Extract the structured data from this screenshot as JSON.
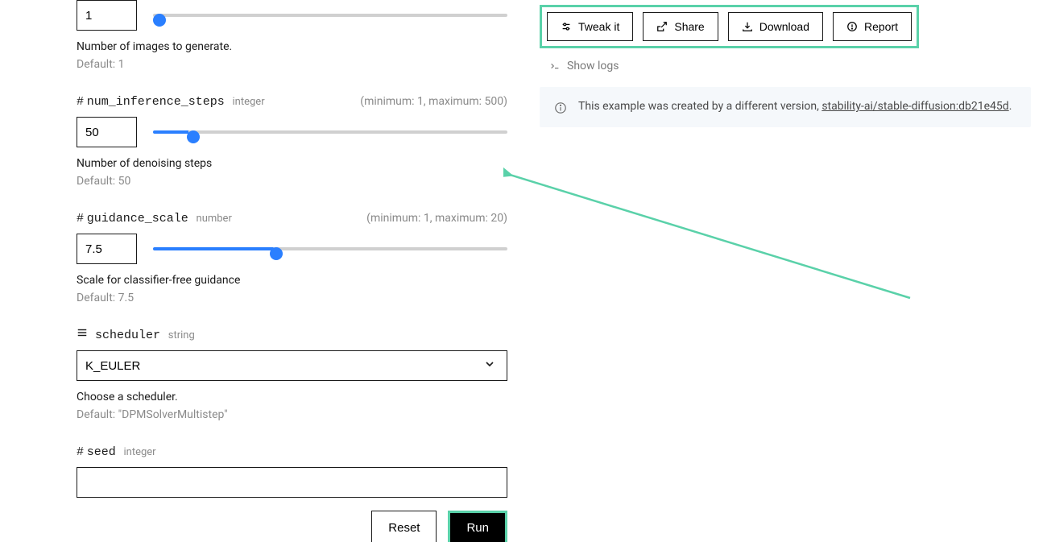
{
  "params": {
    "num_outputs": {
      "value": "1",
      "desc": "Number of images to generate.",
      "default": "Default: 1",
      "slider_min": 1,
      "slider_max": 4,
      "pct": "0%"
    },
    "num_inference_steps": {
      "label": "num_inference_steps",
      "type": "integer",
      "range": "(minimum: 1, maximum: 500)",
      "value": "50",
      "desc": "Number of denoising steps",
      "default": "Default: 50",
      "slider_min": 1,
      "slider_max": 500,
      "pct": "10%"
    },
    "guidance_scale": {
      "label": "guidance_scale",
      "type": "number",
      "range": "(minimum: 1, maximum: 20)",
      "value": "7.5",
      "desc": "Scale for classifier-free guidance",
      "default": "Default: 7.5",
      "slider_min": 1,
      "slider_max": 20,
      "pct": "34%"
    },
    "scheduler": {
      "label": "scheduler",
      "type": "string",
      "value": "K_EULER",
      "desc": "Choose a scheduler.",
      "default": "Default: \"DPMSolverMultistep\""
    },
    "seed": {
      "label": "seed",
      "type": "integer",
      "value": ""
    }
  },
  "buttons": {
    "reset": "Reset",
    "run": "Run",
    "tweak": "Tweak it",
    "share": "Share",
    "download": "Download",
    "report": "Report"
  },
  "logs": "Show logs",
  "info": {
    "text_pre": "This example was created by a different version, ",
    "link": "stability-ai/stable-diffusion:db21e45d",
    "text_post": "."
  }
}
